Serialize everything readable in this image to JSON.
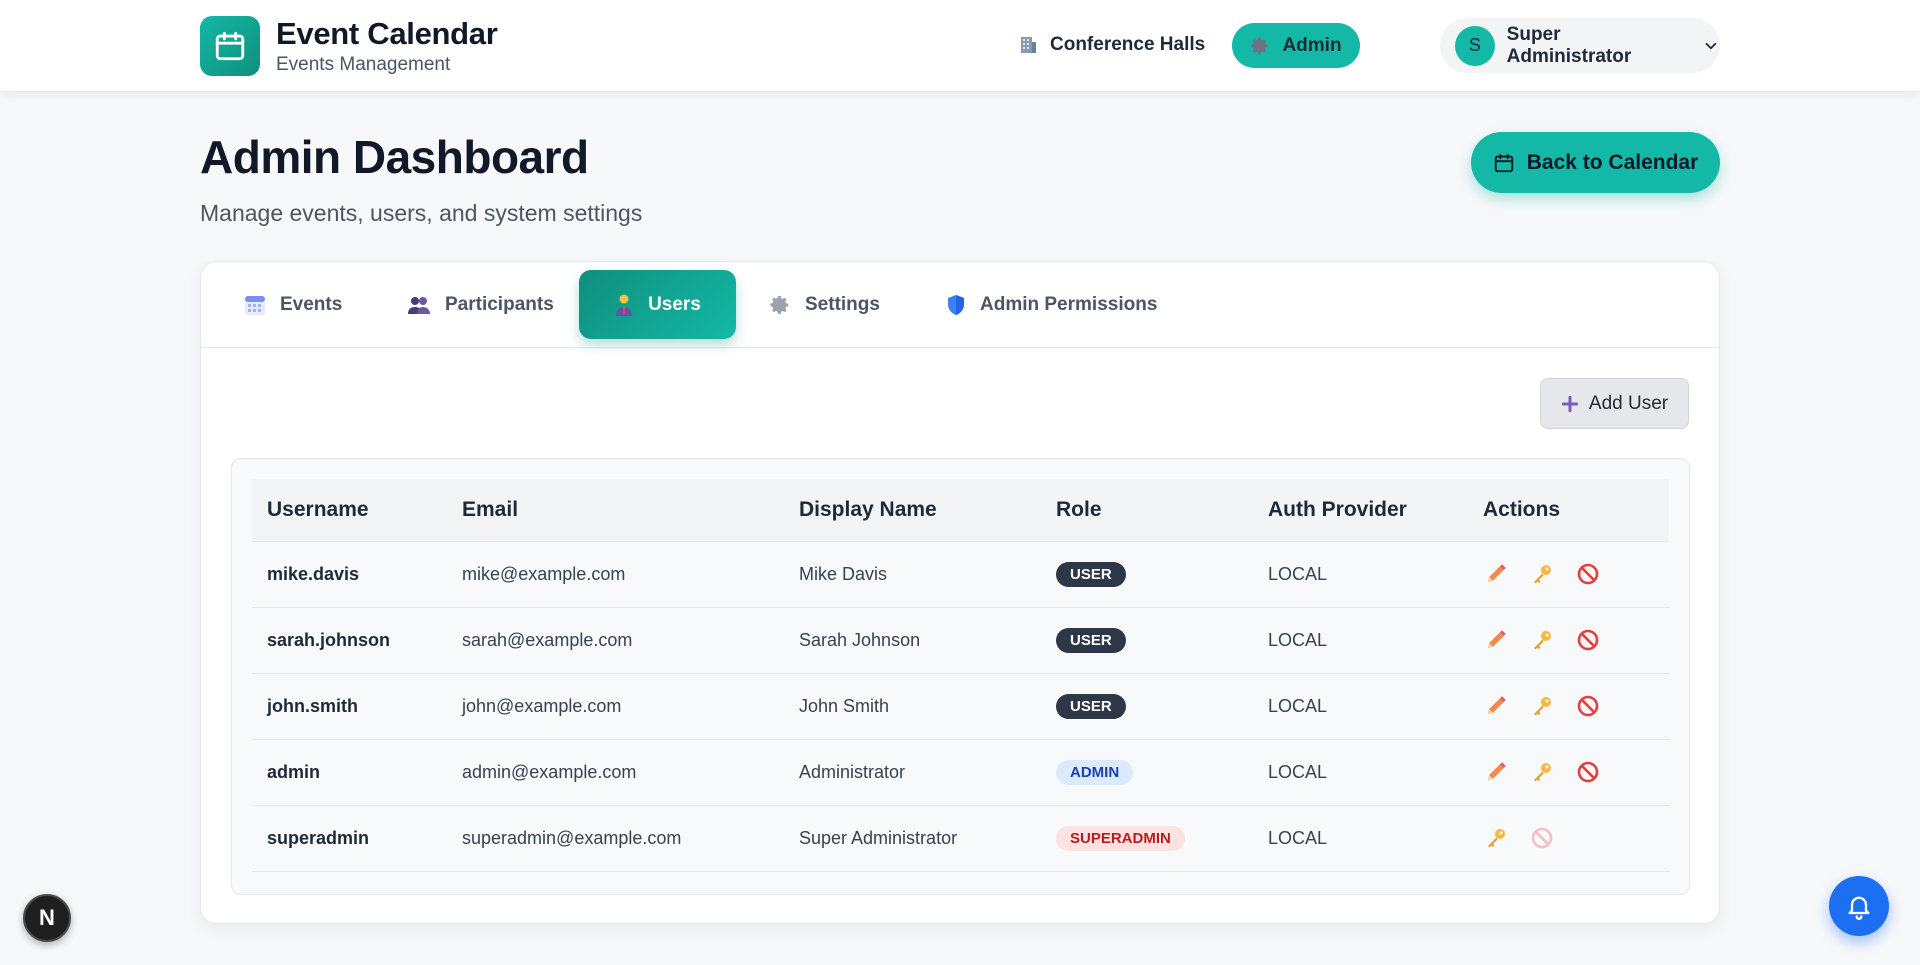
{
  "header": {
    "app_title": "Event Calendar",
    "app_subtitle": "Events Management",
    "nav": {
      "conference_halls": "Conference Halls",
      "admin": "Admin"
    },
    "user": {
      "initial": "S",
      "name": "Super Administrator"
    }
  },
  "page": {
    "title": "Admin Dashboard",
    "subtitle": "Manage events, users, and system settings",
    "back_button": "Back to Calendar"
  },
  "tabs": [
    {
      "label": "Events",
      "icon": "calendar-icon"
    },
    {
      "label": "Participants",
      "icon": "people-icon"
    },
    {
      "label": "Users",
      "icon": "user-icon",
      "active": true
    },
    {
      "label": "Settings",
      "icon": "gear-icon"
    },
    {
      "label": "Admin Permissions",
      "icon": "shield-icon"
    }
  ],
  "users_panel": {
    "add_user": "Add User",
    "columns": [
      "Username",
      "Email",
      "Display Name",
      "Role",
      "Auth Provider",
      "Actions"
    ],
    "rows": [
      {
        "username": "mike.davis",
        "email": "mike@example.com",
        "display_name": "Mike Davis",
        "role": "USER",
        "auth": "LOCAL"
      },
      {
        "username": "sarah.johnson",
        "email": "sarah@example.com",
        "display_name": "Sarah Johnson",
        "role": "USER",
        "auth": "LOCAL"
      },
      {
        "username": "john.smith",
        "email": "john@example.com",
        "display_name": "John Smith",
        "role": "USER",
        "auth": "LOCAL"
      },
      {
        "username": "admin",
        "email": "admin@example.com",
        "display_name": "Administrator",
        "role": "ADMIN",
        "auth": "LOCAL"
      },
      {
        "username": "superadmin",
        "email": "superadmin@example.com",
        "display_name": "Super Administrator",
        "role": "SUPERADMIN",
        "auth": "LOCAL"
      }
    ]
  },
  "floating": {
    "next_badge": "N"
  },
  "colors": {
    "accent": "#14b8a6",
    "accent_dark": "#0f8f7e",
    "bell": "#1d6ff2"
  }
}
